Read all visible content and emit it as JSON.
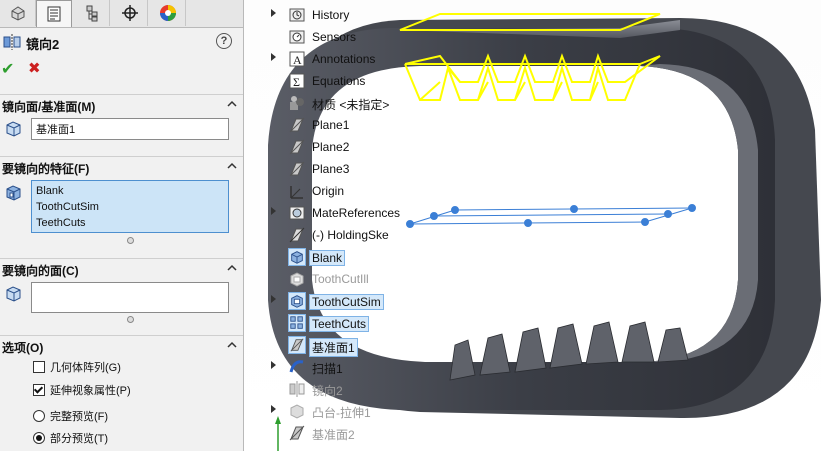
{
  "tabs": [
    {
      "name": "feature-manager-tab-icon"
    },
    {
      "name": "property-manager-tab-icon"
    },
    {
      "name": "configuration-manager-tab-icon"
    },
    {
      "name": "dimxpert-tab-icon"
    },
    {
      "name": "display-manager-tab-icon"
    }
  ],
  "panel": {
    "title": "镜向2",
    "help_label": "?",
    "ok_label": "✔",
    "cancel_label": "✖"
  },
  "mirror_face": {
    "header": "镜向面/基准面(M)",
    "value": "基准面1"
  },
  "features": {
    "header": "要镜向的特征(F)",
    "items": [
      "Blank",
      "ToothCutSim",
      "TeethCuts"
    ]
  },
  "faces": {
    "header": "要镜向的面(C)",
    "value": ""
  },
  "options": {
    "header": "选项(O)",
    "geometry_pattern": {
      "label": "几何体阵列(G)",
      "checked": false
    },
    "propagate_visual": {
      "label": "延伸视象属性(P)",
      "checked": true
    },
    "full_preview": {
      "label": "完整预览(F)",
      "selected": false
    },
    "partial_preview": {
      "label": "部分预览(T)",
      "selected": true
    }
  },
  "tree": [
    {
      "label": "History",
      "icon": "history-folder-icon",
      "expandable": true,
      "state": "normal"
    },
    {
      "label": "Sensors",
      "icon": "sensors-icon",
      "expandable": false,
      "state": "normal"
    },
    {
      "label": "Annotations",
      "icon": "annotations-icon",
      "expandable": true,
      "state": "normal"
    },
    {
      "label": "Equations",
      "icon": "equations-icon",
      "expandable": false,
      "state": "normal"
    },
    {
      "label": "材质 <未指定>",
      "icon": "material-icon",
      "expandable": false,
      "state": "normal"
    },
    {
      "label": "Plane1",
      "icon": "plane-icon",
      "expandable": false,
      "state": "normal"
    },
    {
      "label": "Plane2",
      "icon": "plane-icon",
      "expandable": false,
      "state": "normal"
    },
    {
      "label": "Plane3",
      "icon": "plane-icon",
      "expandable": false,
      "state": "normal"
    },
    {
      "label": "Origin",
      "icon": "origin-icon",
      "expandable": false,
      "state": "normal"
    },
    {
      "label": "MateReferences",
      "icon": "mate-references-icon",
      "expandable": true,
      "state": "normal"
    },
    {
      "label": "(-) HoldingSke",
      "icon": "sketch-icon",
      "expandable": false,
      "state": "normal"
    },
    {
      "label": "Blank",
      "icon": "extrude-icon",
      "expandable": false,
      "state": "highlight"
    },
    {
      "label": "ToothCutIll",
      "icon": "cut-icon",
      "expandable": false,
      "state": "dim"
    },
    {
      "label": "ToothCutSim",
      "icon": "cut-sim-icon",
      "expandable": true,
      "state": "highlight"
    },
    {
      "label": "TeethCuts",
      "icon": "pattern-icon",
      "expandable": false,
      "state": "highlight"
    },
    {
      "label": "基准面1",
      "icon": "plane-icon",
      "expandable": false,
      "state": "highlight"
    },
    {
      "label": "扫描1",
      "icon": "sweep-icon",
      "expandable": true,
      "state": "normal"
    },
    {
      "label": "镜向2",
      "icon": "mirror-icon",
      "expandable": false,
      "state": "dim"
    },
    {
      "label": "凸台-拉伸1",
      "icon": "boss-extrude-icon",
      "expandable": true,
      "state": "dim"
    },
    {
      "label": "基准面2",
      "icon": "plane-icon",
      "expandable": false,
      "state": "dim"
    }
  ],
  "colors": {
    "selection_yellow": "#ffff00",
    "preview_blue": "#3b7fd6",
    "body_gray": "#4a4d55",
    "highlight_bg": "#d4e8fa"
  }
}
